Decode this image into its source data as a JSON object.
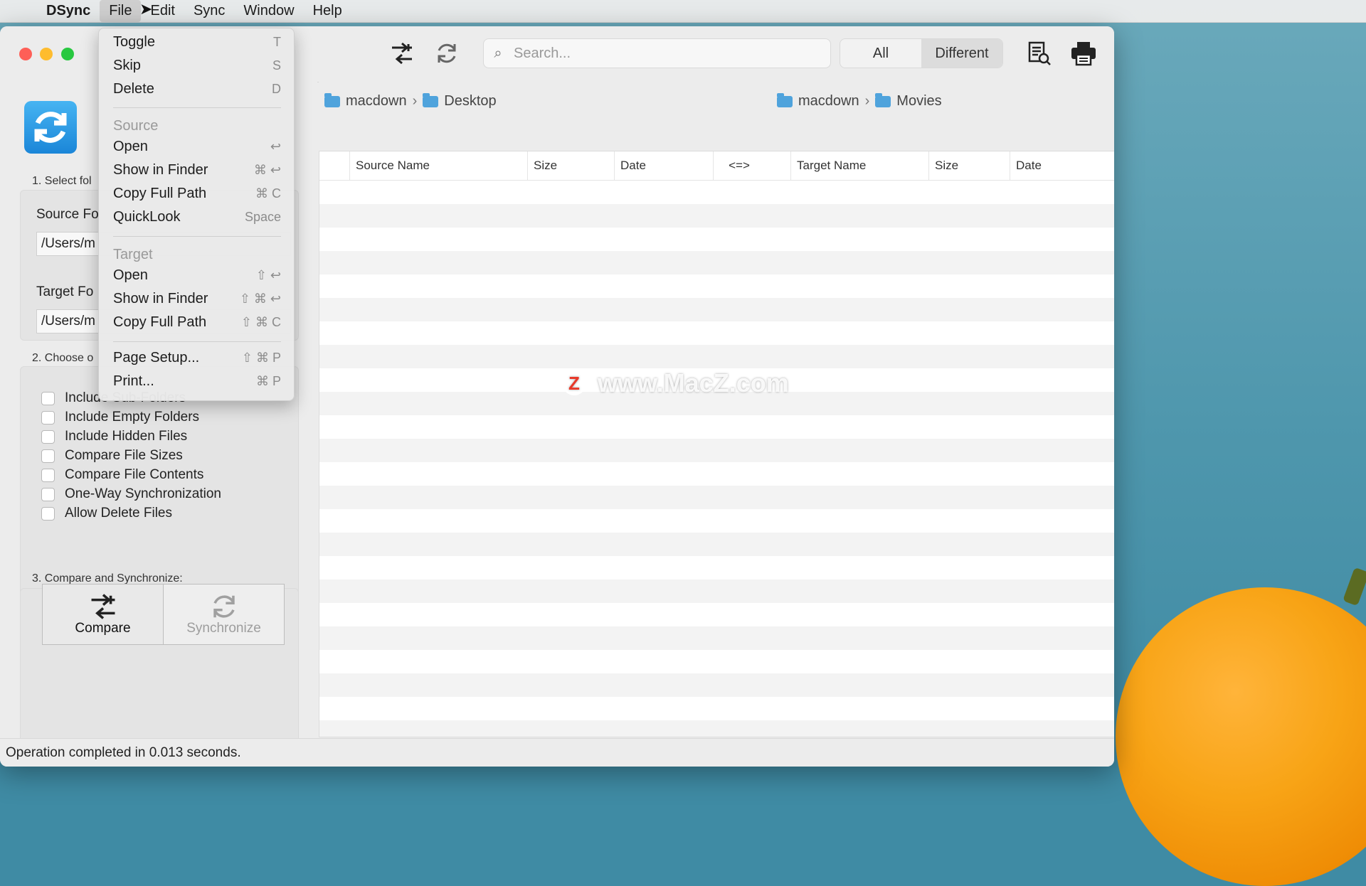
{
  "menubar": {
    "app": "DSync",
    "items": [
      "File",
      "Edit",
      "Sync",
      "Window",
      "Help"
    ]
  },
  "file_menu": {
    "top_items": [
      {
        "label": "Toggle",
        "shortcut": "T"
      },
      {
        "label": "Skip",
        "shortcut": "S"
      },
      {
        "label": "Delete",
        "shortcut": "D"
      }
    ],
    "source_header": "Source",
    "source_items": [
      {
        "label": "Open",
        "shortcut": "↩"
      },
      {
        "label": "Show in Finder",
        "shortcut": "⌘ ↩"
      },
      {
        "label": "Copy Full Path",
        "shortcut": "⌘ C"
      },
      {
        "label": "QuickLook",
        "shortcut": "Space"
      }
    ],
    "target_header": "Target",
    "target_items": [
      {
        "label": "Open",
        "shortcut": "⇧ ↩"
      },
      {
        "label": "Show in Finder",
        "shortcut": "⇧ ⌘ ↩"
      },
      {
        "label": "Copy Full Path",
        "shortcut": "⇧ ⌘ C"
      }
    ],
    "bottom_items": [
      {
        "label": "Page Setup...",
        "shortcut": "⇧ ⌘ P"
      },
      {
        "label": "Print...",
        "shortcut": "⌘ P"
      }
    ]
  },
  "toolbar": {
    "search_placeholder": "Search...",
    "filter": [
      "All",
      "Different"
    ]
  },
  "left_panel": {
    "step1": "1. Select fol",
    "source_label": "Source Fo",
    "source_path": "/Users/m",
    "target_label": "Target Fo",
    "target_path": "/Users/m",
    "step2": "2. Choose o",
    "options": [
      "Include Sub-Folders",
      "Include Empty Folders",
      "Include Hidden Files",
      "Compare File Sizes",
      "Compare File Contents",
      "One-Way Synchronization",
      "Allow Delete Files"
    ],
    "step3": "3. Compare and Synchronize:",
    "compare_label": "Compare",
    "synchronize_label": "Synchronize"
  },
  "breadcrumbs": {
    "source": [
      "macdown",
      "Desktop"
    ],
    "target": [
      "macdown",
      "Movies"
    ]
  },
  "table": {
    "columns": [
      "Source Name",
      "Size",
      "Date",
      "<=>",
      "Target Name",
      "Size",
      "Date"
    ]
  },
  "watermark": "www.MacZ.com",
  "status": "Operation completed in 0.013 seconds."
}
